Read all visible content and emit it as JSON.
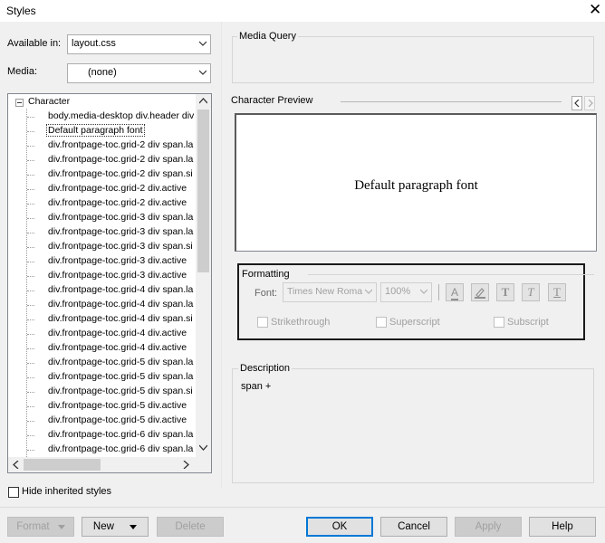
{
  "window": {
    "title": "Styles"
  },
  "available_in": {
    "label": "Available in:",
    "value": "layout.css"
  },
  "media": {
    "label": "Media:",
    "value": "(none)"
  },
  "tree": {
    "root": "Character",
    "items": [
      "body.media-desktop div.header div",
      "Default paragraph font",
      "div.frontpage-toc.grid-2 div span.la",
      "div.frontpage-toc.grid-2 div span.la",
      "div.frontpage-toc.grid-2 div span.si",
      "div.frontpage-toc.grid-2 div.active",
      "div.frontpage-toc.grid-2 div.active",
      "div.frontpage-toc.grid-3 div span.la",
      "div.frontpage-toc.grid-3 div span.la",
      "div.frontpage-toc.grid-3 div span.si",
      "div.frontpage-toc.grid-3 div.active",
      "div.frontpage-toc.grid-3 div.active",
      "div.frontpage-toc.grid-4 div span.la",
      "div.frontpage-toc.grid-4 div span.la",
      "div.frontpage-toc.grid-4 div span.si",
      "div.frontpage-toc.grid-4 div.active",
      "div.frontpage-toc.grid-4 div.active",
      "div.frontpage-toc.grid-5 div span.la",
      "div.frontpage-toc.grid-5 div span.la",
      "div.frontpage-toc.grid-5 div span.si",
      "div.frontpage-toc.grid-5 div.active",
      "div.frontpage-toc.grid-5 div.active",
      "div.frontpage-toc.grid-6 div span.la",
      "div.frontpage-toc.grid-6 div span.la"
    ],
    "selected_index": 1
  },
  "hide_inherited": {
    "label": "Hide inherited styles",
    "checked": false
  },
  "media_query": {
    "label": "Media Query"
  },
  "character_preview": {
    "label": "Character Preview",
    "sample": "Default paragraph font"
  },
  "formatting": {
    "label": "Formatting",
    "font_label": "Font:",
    "font_value": "Times New Roma",
    "size_value": "100%",
    "strikethrough": "Strikethrough",
    "superscript": "Superscript",
    "subscript": "Subscript",
    "highlight_color": "#2f2f2f"
  },
  "description": {
    "label": "Description",
    "text": "span +"
  },
  "buttons": {
    "format": "Format",
    "new": "New",
    "delete": "Delete",
    "ok": "OK",
    "cancel": "Cancel",
    "apply": "Apply",
    "help": "Help"
  },
  "colors": {
    "accent": "#0078d7",
    "window_bg": "#f0f0f0"
  }
}
